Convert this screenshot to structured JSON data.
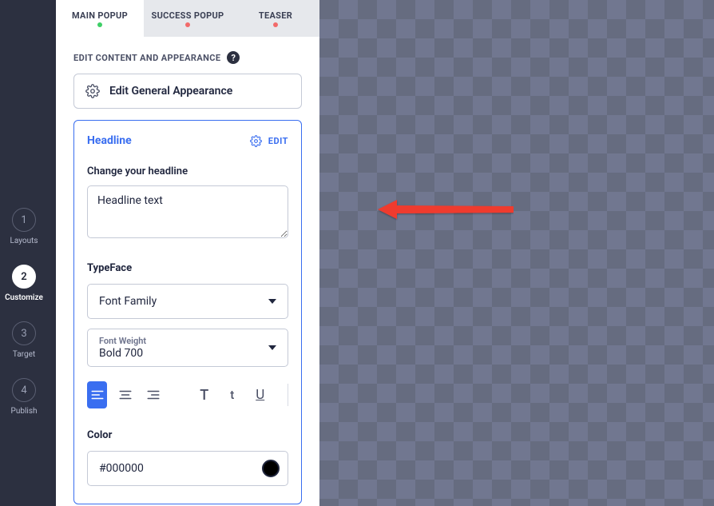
{
  "steps": [
    {
      "num": "1",
      "label": "Layouts"
    },
    {
      "num": "2",
      "label": "Customize"
    },
    {
      "num": "3",
      "label": "Target"
    },
    {
      "num": "4",
      "label": "Publish"
    }
  ],
  "tabs": [
    {
      "label": "MAIN POPUP",
      "dot": "green"
    },
    {
      "label": "SUCCESS POPUP",
      "dot": "red"
    },
    {
      "label": "TEASER",
      "dot": "red"
    }
  ],
  "section_header": "EDIT CONTENT AND APPEARANCE",
  "general_button": "Edit General Appearance",
  "card": {
    "title": "Headline",
    "edit_label": "EDIT",
    "change_label": "Change your headline",
    "headline_value": "Headline text",
    "typeface_label": "TypeFace",
    "font_family_placeholder": "Font Family",
    "font_weight_mini": "Font Weight",
    "font_weight_value": "Bold 700",
    "color_label": "Color",
    "color_hex": "#000000",
    "color_swatch": "#000000"
  }
}
